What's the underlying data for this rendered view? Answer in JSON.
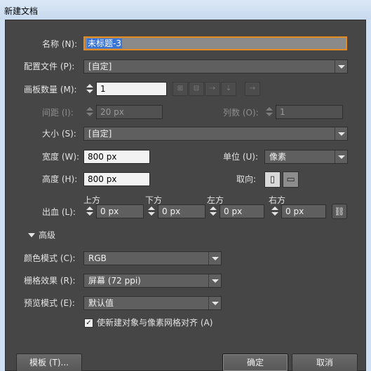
{
  "window": {
    "title": "新建文档"
  },
  "name": {
    "label": "名称 (N):",
    "value": "未标题-3"
  },
  "profile": {
    "label": "配置文件 (P):",
    "value": "[自定]"
  },
  "artboards": {
    "count_label": "画板数量 (M):",
    "count_value": "1",
    "layout_icons": [
      "grid-by-row-icon",
      "grid-by-column-icon",
      "arrange-by-row-icon",
      "arrange-by-column-icon",
      "right-to-left-icon"
    ],
    "spacing_label": "间距 (I):",
    "spacing_value": "20 px",
    "columns_label": "列数 (O):",
    "columns_value": "1"
  },
  "size": {
    "label": "大小 (S):",
    "value": "[自定]"
  },
  "width": {
    "label": "宽度 (W):",
    "value": "800 px"
  },
  "height": {
    "label": "高度 (H):",
    "value": "800 px"
  },
  "units": {
    "label": "单位 (U):",
    "value": "像素"
  },
  "orientation": {
    "label": "取向:",
    "selected": "portrait"
  },
  "bleed": {
    "label": "出血 (L):",
    "top_label": "上方",
    "top_value": "0 px",
    "bottom_label": "下方",
    "bottom_value": "0 px",
    "left_label": "左方",
    "left_value": "0 px",
    "right_label": "右方",
    "right_value": "0 px"
  },
  "advanced": {
    "heading": "高级",
    "color_mode_label": "颜色模式 (C):",
    "color_mode_value": "RGB",
    "raster_label": "栅格效果 (R):",
    "raster_value": "屏幕 (72 ppi)",
    "preview_label": "预览模式 (E):",
    "preview_value": "默认值",
    "align_checkbox_label": "使新建对象与像素网格对齐 (A)",
    "align_checked": true
  },
  "buttons": {
    "templates": "模板 (T)...",
    "ok": "确定",
    "cancel": "取消"
  },
  "colors": {
    "panel": "#464646",
    "focus": "#e58a1f",
    "selection": "#3a74d4"
  }
}
